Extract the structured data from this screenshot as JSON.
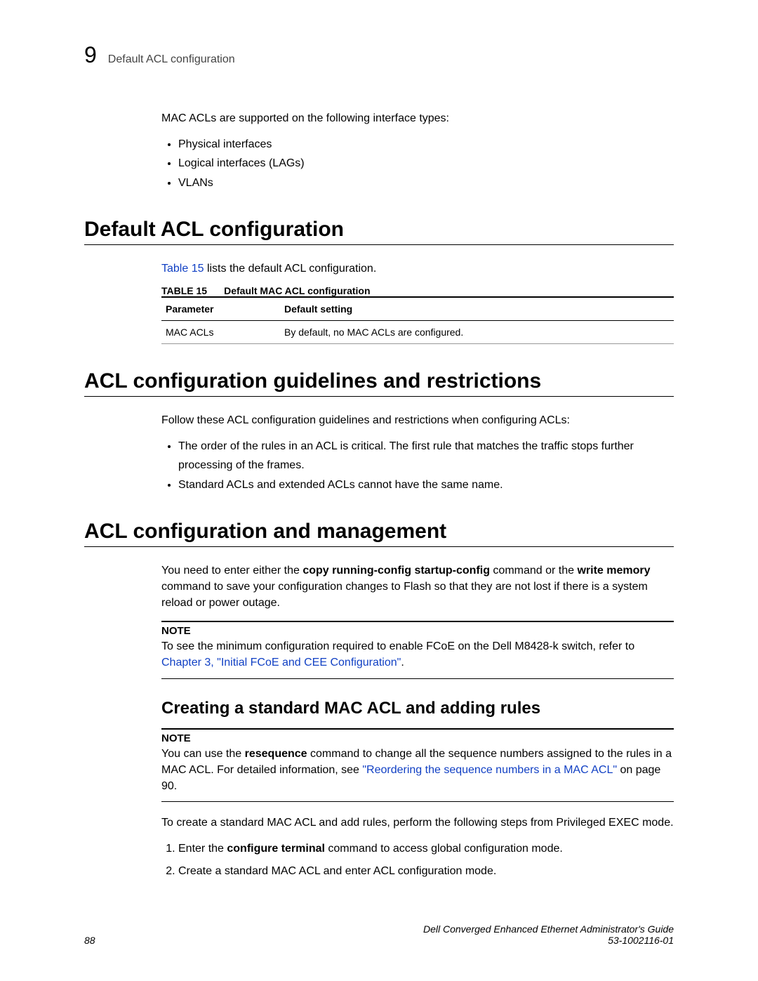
{
  "header": {
    "chapter_number": "9",
    "running_title": "Default ACL configuration"
  },
  "intro": {
    "text": "MAC ACLs are supported on the following interface types:",
    "bullets": [
      "Physical interfaces",
      "Logical interfaces (LAGs)",
      "VLANs"
    ]
  },
  "section1": {
    "heading": "Default ACL configuration",
    "para_pre": "",
    "xref": "Table 15",
    "para_post": " lists the default ACL configuration.",
    "table": {
      "label": "TABLE 15",
      "title": "Default MAC ACL configuration",
      "headers": [
        "Parameter",
        "Default setting"
      ],
      "rows": [
        [
          "MAC ACLs",
          "By default, no MAC ACLs are configured."
        ]
      ]
    }
  },
  "section2": {
    "heading": "ACL configuration guidelines and restrictions",
    "para": "Follow these ACL configuration guidelines and restrictions when configuring ACLs:",
    "bullets": [
      "The order of the rules in an ACL is critical. The first rule that matches the traffic stops further processing of the frames.",
      "Standard ACLs and extended ACLs cannot have the same name."
    ]
  },
  "section3": {
    "heading": "ACL configuration and management",
    "para1_a": "You need to enter either the ",
    "para1_bold1": "copy running-config startup-config",
    "para1_b": " command or the ",
    "para1_bold2": "write memory",
    "para1_c": " command to save your configuration changes to Flash so that they are not lost if there is a system reload or power outage.",
    "note1": {
      "label": "NOTE",
      "text_a": "To see the minimum configuration required to enable FCoE on the Dell M8428-k switch, refer to ",
      "link": "Chapter 3, \"Initial FCoE and CEE Configuration\"",
      "text_b": "."
    },
    "subsection": {
      "heading": "Creating a standard MAC ACL and adding rules",
      "note": {
        "label": "NOTE",
        "text_a": "You can use the ",
        "bold": "resequence",
        "text_b": " command to change all the sequence numbers assigned to the rules in a MAC ACL. For detailed information, see ",
        "link": "\"Reordering the sequence numbers in a MAC ACL\"",
        "text_c": " on page 90."
      },
      "para": "To create a standard MAC ACL and add rules, perform the following steps from Privileged EXEC mode.",
      "steps": {
        "s1_a": "Enter the ",
        "s1_bold": "configure terminal",
        "s1_b": " command to access global configuration mode.",
        "s2": "Create a standard MAC ACL and enter ACL configuration mode."
      }
    }
  },
  "footer": {
    "page": "88",
    "guide": "Dell Converged Enhanced Ethernet Administrator's Guide",
    "docnum": "53-1002116-01"
  }
}
